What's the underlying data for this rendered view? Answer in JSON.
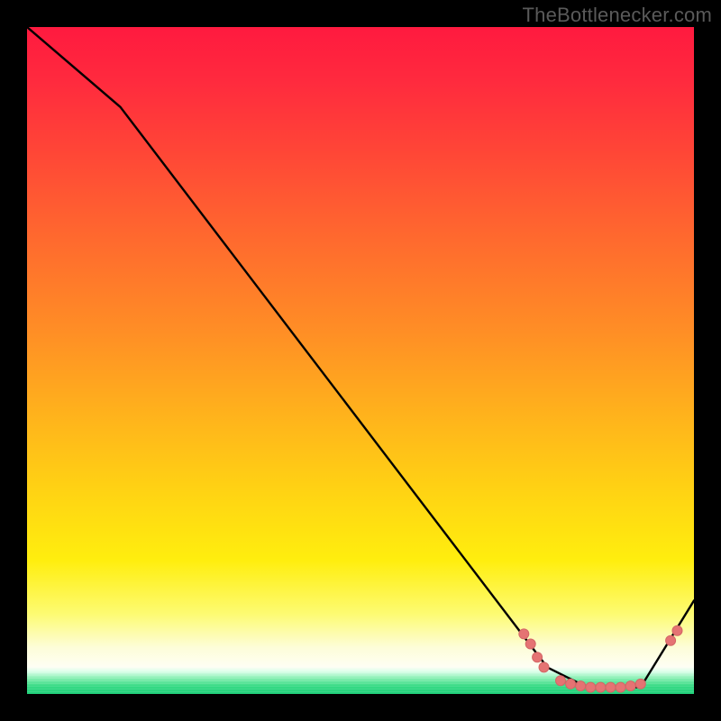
{
  "watermark": "TheBottlenecker.com",
  "colors": {
    "line": "#000000",
    "marker_fill": "#e57373",
    "marker_stroke": "#d36666",
    "gradient_top": "#ff1a3f",
    "gradient_mid": "#ffd413",
    "gradient_bottom_green": "#1fd07a"
  },
  "chart_data": {
    "type": "line",
    "title": "",
    "xlabel": "",
    "ylabel": "",
    "xlim": [
      0,
      100
    ],
    "ylim": [
      0,
      100
    ],
    "line_points": [
      {
        "x": 0,
        "y": 100
      },
      {
        "x": 14,
        "y": 88
      },
      {
        "x": 78,
        "y": 4
      },
      {
        "x": 84,
        "y": 1
      },
      {
        "x": 92,
        "y": 1
      },
      {
        "x": 100,
        "y": 14
      }
    ],
    "marker_points": [
      {
        "x": 74.5,
        "y": 9.0
      },
      {
        "x": 75.5,
        "y": 7.5
      },
      {
        "x": 76.5,
        "y": 5.5
      },
      {
        "x": 77.5,
        "y": 4.0
      },
      {
        "x": 80.0,
        "y": 2.0
      },
      {
        "x": 81.5,
        "y": 1.5
      },
      {
        "x": 83.0,
        "y": 1.2
      },
      {
        "x": 84.5,
        "y": 1.0
      },
      {
        "x": 86.0,
        "y": 1.0
      },
      {
        "x": 87.5,
        "y": 1.0
      },
      {
        "x": 89.0,
        "y": 1.0
      },
      {
        "x": 90.5,
        "y": 1.2
      },
      {
        "x": 92.0,
        "y": 1.5
      },
      {
        "x": 96.5,
        "y": 8.0
      },
      {
        "x": 97.5,
        "y": 9.5
      }
    ]
  }
}
